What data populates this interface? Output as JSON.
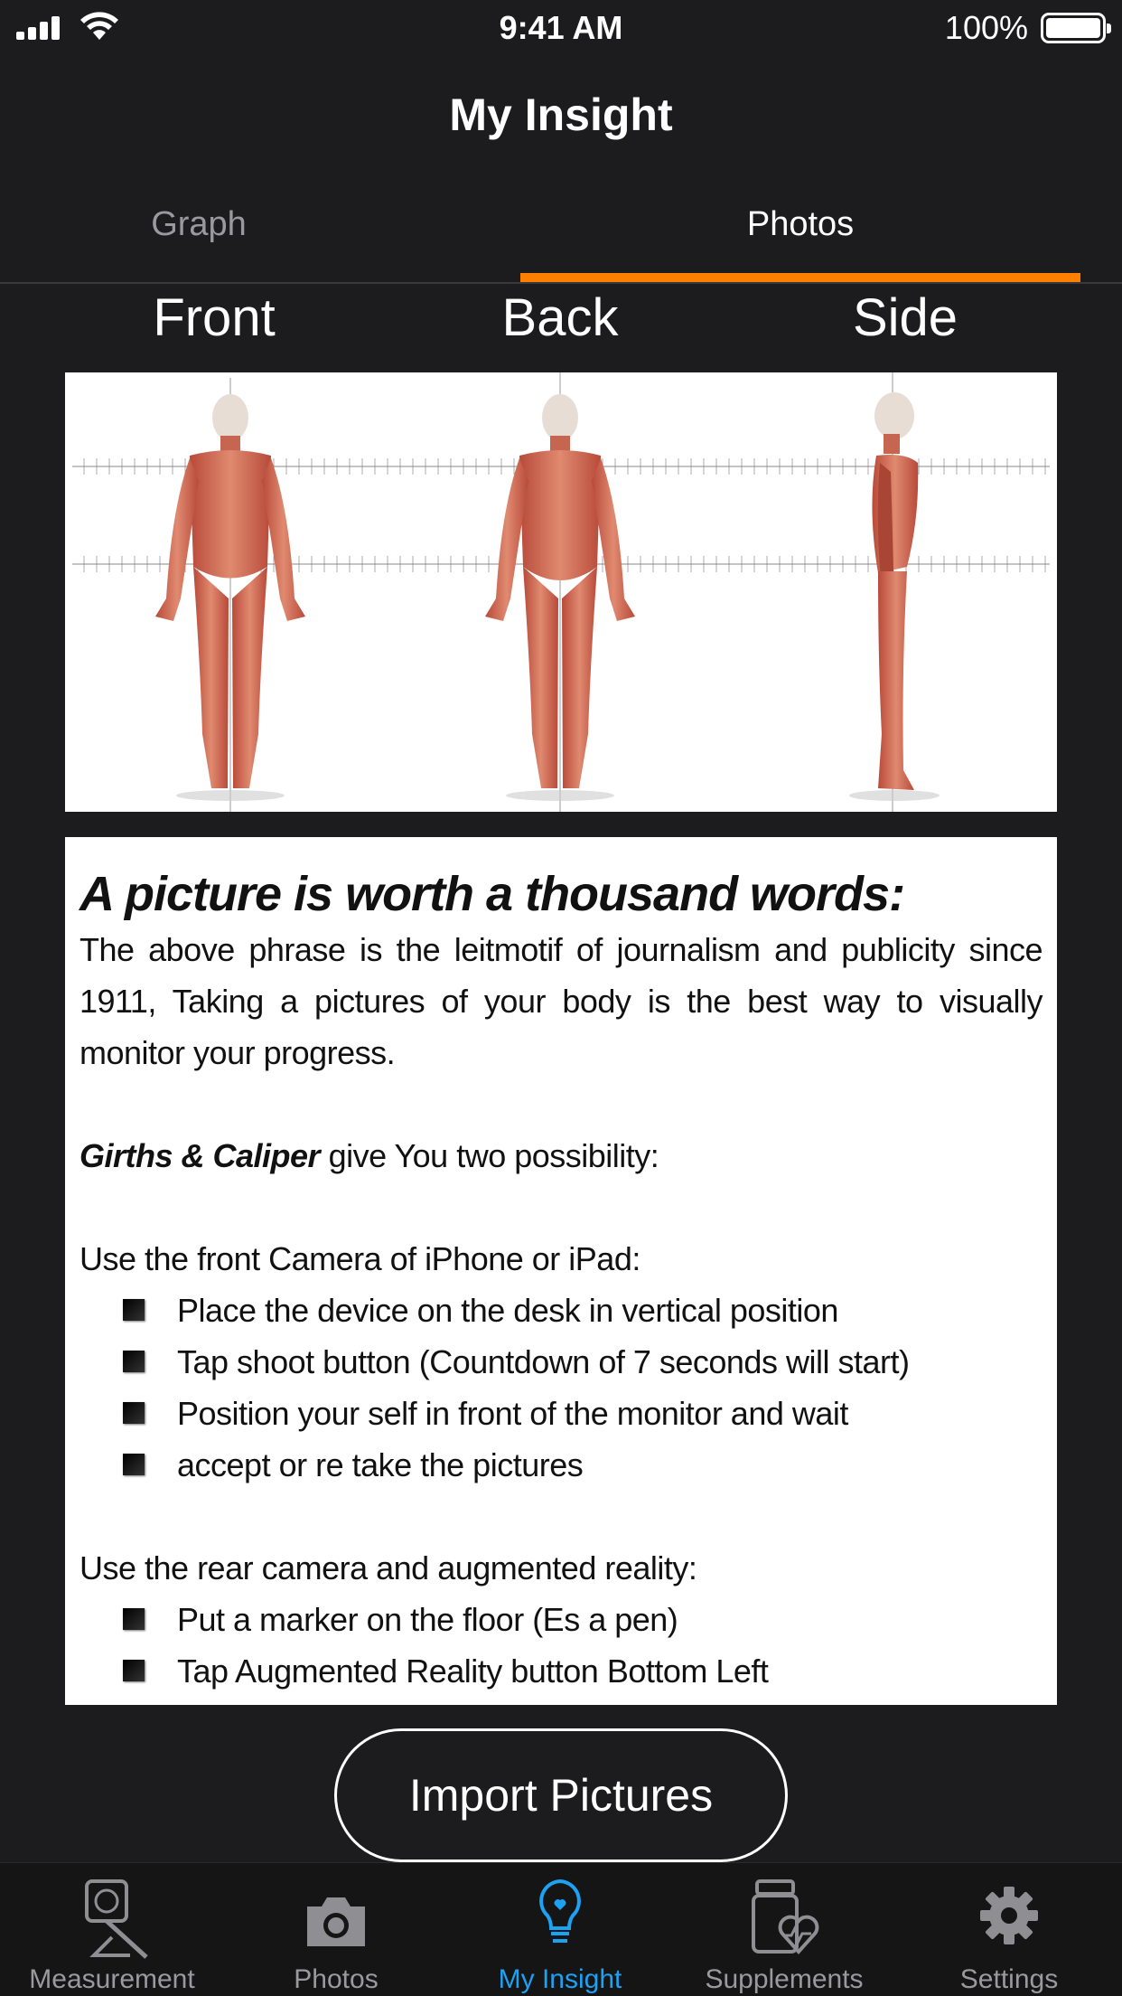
{
  "status_bar": {
    "time": "9:41 AM",
    "battery_percent": "100%"
  },
  "nav": {
    "title": "My Insight"
  },
  "tabs": [
    {
      "label": "Graph",
      "selected": false
    },
    {
      "label": "Photos",
      "selected": true
    }
  ],
  "views": {
    "front": "Front",
    "back": "Back",
    "side": "Side"
  },
  "info": {
    "title": "A picture is worth a thousand words:",
    "intro": "The above phrase is the leitmotif of journalism and publicity  since 1911, Taking a pictures of your body is the best way to visually monitor your progress.",
    "brand": "Girths & Caliper",
    "brand_suffix": " give You two possibility:",
    "front_camera_heading": "Use the front Camera of iPhone or iPad:",
    "front_steps": [
      "Place the device on the desk in vertical position",
      "Tap shoot button (Countdown of 7 seconds will start)",
      "Position your self in front of the monitor and wait",
      "accept or re take the pictures"
    ],
    "rear_camera_heading": "Use the rear camera and augmented reality:",
    "rear_steps": [
      "Put a marker on the floor (Es a pen)",
      "Tap Augmented Reality button Bottom Left"
    ]
  },
  "import_button": {
    "label": "Import Pictures"
  },
  "tabbar": [
    {
      "label": "Measurement",
      "icon": "tape-measure-icon",
      "active": false
    },
    {
      "label": "Photos",
      "icon": "camera-icon",
      "active": false
    },
    {
      "label": "My Insight",
      "icon": "lightbulb-icon",
      "active": true
    },
    {
      "label": "Supplements",
      "icon": "supplements-heart-icon",
      "active": false
    },
    {
      "label": "Settings",
      "icon": "gear-icon",
      "active": false
    }
  ],
  "colors": {
    "accent": "#ff7f00",
    "active_tab": "#1da1f2",
    "background": "#1c1c1e"
  }
}
